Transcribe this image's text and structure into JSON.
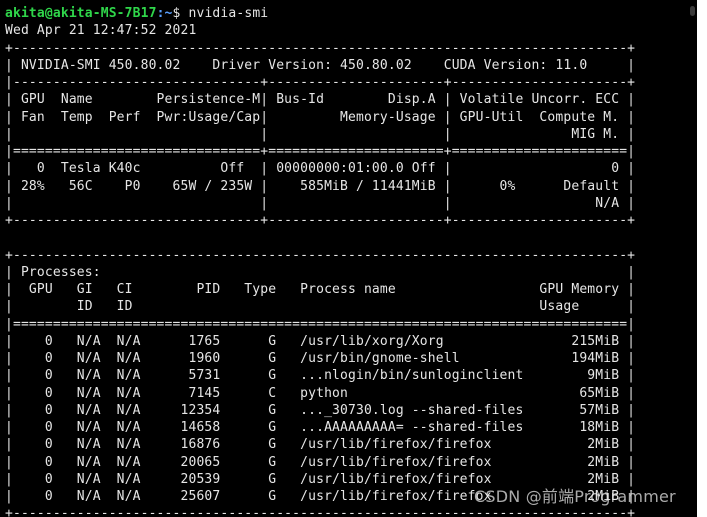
{
  "prompt": {
    "user_host": "akita@akita-MS-7B17",
    "path": ":~",
    "symbol": "$",
    "command": "nvidia-smi"
  },
  "timestamp": "Wed Apr 21 12:47:52 2021",
  "smi_header": {
    "border_top": "+-----------------------------------------------------------------------------+",
    "version_line": "| NVIDIA-SMI 450.80.02    Driver Version: 450.80.02    CUDA Version: 11.0     |",
    "sep_1": "|-------------------------------+----------------------+----------------------+",
    "col_head_1": "| GPU  Name        Persistence-M| Bus-Id        Disp.A | Volatile Uncorr. ECC |",
    "col_head_2": "| Fan  Temp  Perf  Pwr:Usage/Cap|         Memory-Usage | GPU-Util  Compute M. |",
    "col_head_3": "|                               |                      |               MIG M. |",
    "sep_double": "|===============================+======================+======================|"
  },
  "gpus": [
    {
      "line_1": "|   0  Tesla K40c          Off  | 00000000:01:00.0 Off |                    0 |",
      "line_2": "| 28%   56C    P0    65W / 235W |    585MiB / 11441MiB |      0%      Default |",
      "line_3": "|                               |                      |                  N/A |",
      "border": "+-------------------------------+----------------------+----------------------+"
    }
  ],
  "processes": {
    "border_top": "+-----------------------------------------------------------------------------+",
    "title_line": "| Processes:                                                                  |",
    "head_1": "|  GPU   GI   CI        PID   Type   Process name                  GPU Memory |",
    "head_2": "|        ID   ID                                                   Usage      |",
    "sep_double": "|=============================================================================|",
    "rows": [
      "|    0   N/A  N/A      1765      G   /usr/lib/xorg/Xorg                215MiB |",
      "|    0   N/A  N/A      1960      G   /usr/bin/gnome-shell              194MiB |",
      "|    0   N/A  N/A      5731      G   ...nlogin/bin/sunloginclient        9MiB |",
      "|    0   N/A  N/A      7145      C   python                             65MiB |",
      "|    0   N/A  N/A     12354      G   ..._30730.log --shared-files       57MiB |",
      "|    0   N/A  N/A     14658      G   ...AAAAAAAAA= --shared-files       18MiB |",
      "|    0   N/A  N/A     16876      G   /usr/lib/firefox/firefox            2MiB |",
      "|    0   N/A  N/A     20065      G   /usr/lib/firefox/firefox            2MiB |",
      "|    0   N/A  N/A     20539      G   /usr/lib/firefox/firefox            2MiB |",
      "|    0   N/A  N/A     25607      G   /usr/lib/firefox/firefox            2MiB |"
    ],
    "border_bottom": "+-----------------------------------------------------------------------------+"
  },
  "watermark": "CSDN @前端Programmer",
  "colors": {
    "background": "#000000",
    "text": "#e6e6e6",
    "user_host": "#2fd64a",
    "path": "#5aa0ff"
  }
}
